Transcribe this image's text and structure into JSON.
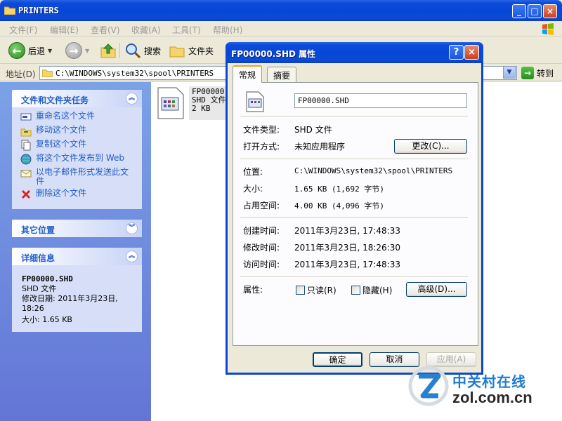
{
  "explorer": {
    "title": "PRINTERS",
    "menu": [
      "文件(F)",
      "编辑(E)",
      "查看(V)",
      "收藏(A)",
      "工具(T)",
      "帮助(H)"
    ],
    "toolbar": {
      "back": "后退",
      "search": "搜索",
      "folders": "文件夹"
    },
    "address": {
      "label": "地址(D)",
      "path": "C:\\WINDOWS\\system32\\spool\\PRINTERS",
      "go": "转到"
    },
    "tasks": {
      "title": "文件和文件夹任务",
      "items": [
        {
          "label": "重命名这个文件"
        },
        {
          "label": "移动这个文件"
        },
        {
          "label": "复制这个文件"
        },
        {
          "label": "将这个文件发布到 Web"
        },
        {
          "label": "以电子邮件形式发送此文件"
        },
        {
          "label": "删除这个文件"
        }
      ]
    },
    "other_places": {
      "title": "其它位置"
    },
    "details": {
      "title": "详细信息",
      "name": "FP00000.SHD",
      "type": "SHD 文件",
      "modified": "修改日期: 2011年3月23日, 18:26",
      "size": "大小: 1.65 KB"
    },
    "file": {
      "name": "FP00000.SHD",
      "type": "SHD 文件",
      "size": "2 KB"
    }
  },
  "dialog": {
    "title": "FP00000.SHD 属性",
    "tabs": [
      "常规",
      "摘要"
    ],
    "filename": "FP00000.SHD",
    "rows": {
      "type": {
        "label": "文件类型:",
        "value": "SHD 文件"
      },
      "open": {
        "label": "打开方式:",
        "value": "未知应用程序",
        "button": "更改(C)..."
      },
      "location": {
        "label": "位置:",
        "value": "C:\\WINDOWS\\system32\\spool\\PRINTERS"
      },
      "size": {
        "label": "大小:",
        "value": "1.65 KB (1,692 字节)"
      },
      "disk": {
        "label": "占用空间:",
        "value": "4.00 KB (4,096 字节)"
      },
      "created": {
        "label": "创建时间:",
        "value": "2011年3月23日, 17:48:33"
      },
      "modified": {
        "label": "修改时间:",
        "value": "2011年3月23日, 18:26:30"
      },
      "accessed": {
        "label": "访问时间:",
        "value": "2011年3月23日, 17:48:33"
      },
      "attributes": {
        "label": "属性:",
        "readonly": "只读(R)",
        "hidden": "隐藏(H)",
        "advanced": "高级(D)..."
      }
    },
    "buttons": {
      "ok": "确定",
      "cancel": "取消",
      "apply": "应用(A)"
    }
  },
  "watermark": {
    "cn": "中关村在线",
    "en": "zol.com.cn"
  }
}
